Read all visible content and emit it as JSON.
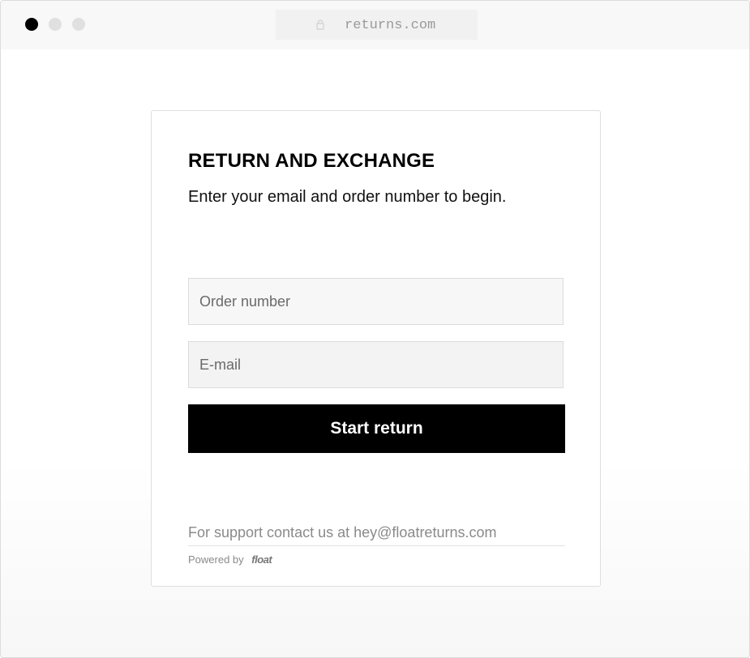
{
  "browser": {
    "url": "returns.com",
    "icons": {
      "lock": "lock-icon"
    }
  },
  "form": {
    "heading": "RETURN AND EXCHANGE",
    "subheading": "Enter your email and order number to begin.",
    "order_number": {
      "placeholder": "Order number",
      "value": ""
    },
    "email": {
      "placeholder": "E-mail",
      "value": ""
    },
    "submit_label": "Start return"
  },
  "footer": {
    "support_prefix": "For support contact us at",
    "support_email": "hey@floatreturns.com",
    "powered_by": "Powered by",
    "brand": "float"
  },
  "colors": {
    "button_bg": "#000000",
    "button_text": "#ffffff",
    "field_bg": "#f7f7f7"
  }
}
